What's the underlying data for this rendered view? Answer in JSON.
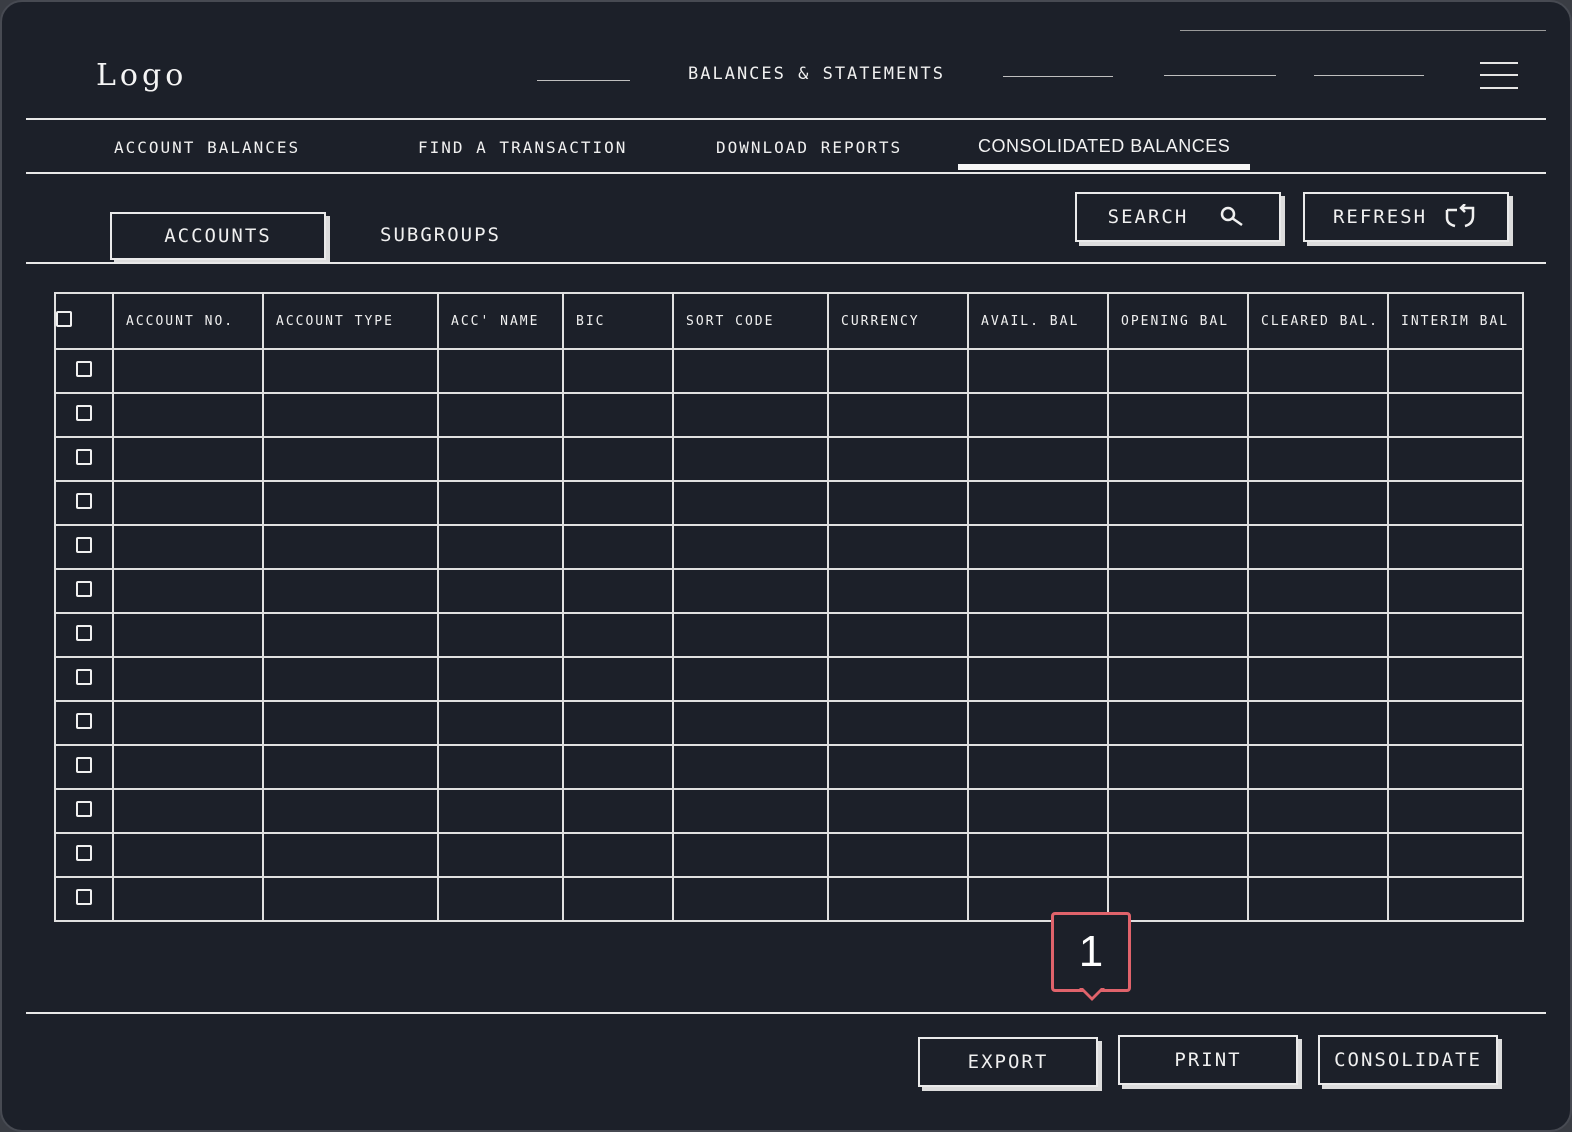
{
  "header": {
    "logo": "Logo",
    "title": "BALANCES & STATEMENTS"
  },
  "nav": {
    "tabs": [
      {
        "label": "ACCOUNT BALANCES"
      },
      {
        "label": "FIND A TRANSACTION"
      },
      {
        "label": "DOWNLOAD REPORTS"
      },
      {
        "label": "CONSOLIDATED BALANCES"
      }
    ],
    "active_tab": "CONSOLIDATED BALANCES"
  },
  "subtabs": {
    "accounts": "ACCOUNTS",
    "subgroups": "SUBGROUPS"
  },
  "toolbar": {
    "search_label": "SEARCH",
    "refresh_label": "REFRESH",
    "search_icon": "search-icon",
    "refresh_icon": "refresh-icon"
  },
  "table": {
    "columns": [
      "ACCOUNT NO.",
      "ACCOUNT TYPE",
      "ACC' NAME",
      "BIC",
      "SORT CODE",
      "CURRENCY",
      "AVAIL. BAL",
      "OPENING BAL",
      "CLEARED BAL.",
      "INTERIM BAL"
    ],
    "row_count": 13
  },
  "callout": {
    "number": "1",
    "color": "#e0636b"
  },
  "footer": {
    "export_label": "EXPORT",
    "print_label": "PRINT",
    "consolidate_label": "CONSOLIDATE"
  },
  "colors": {
    "background": "#1c2029",
    "ink": "#f0f0f0",
    "accent": "#e0636b"
  }
}
